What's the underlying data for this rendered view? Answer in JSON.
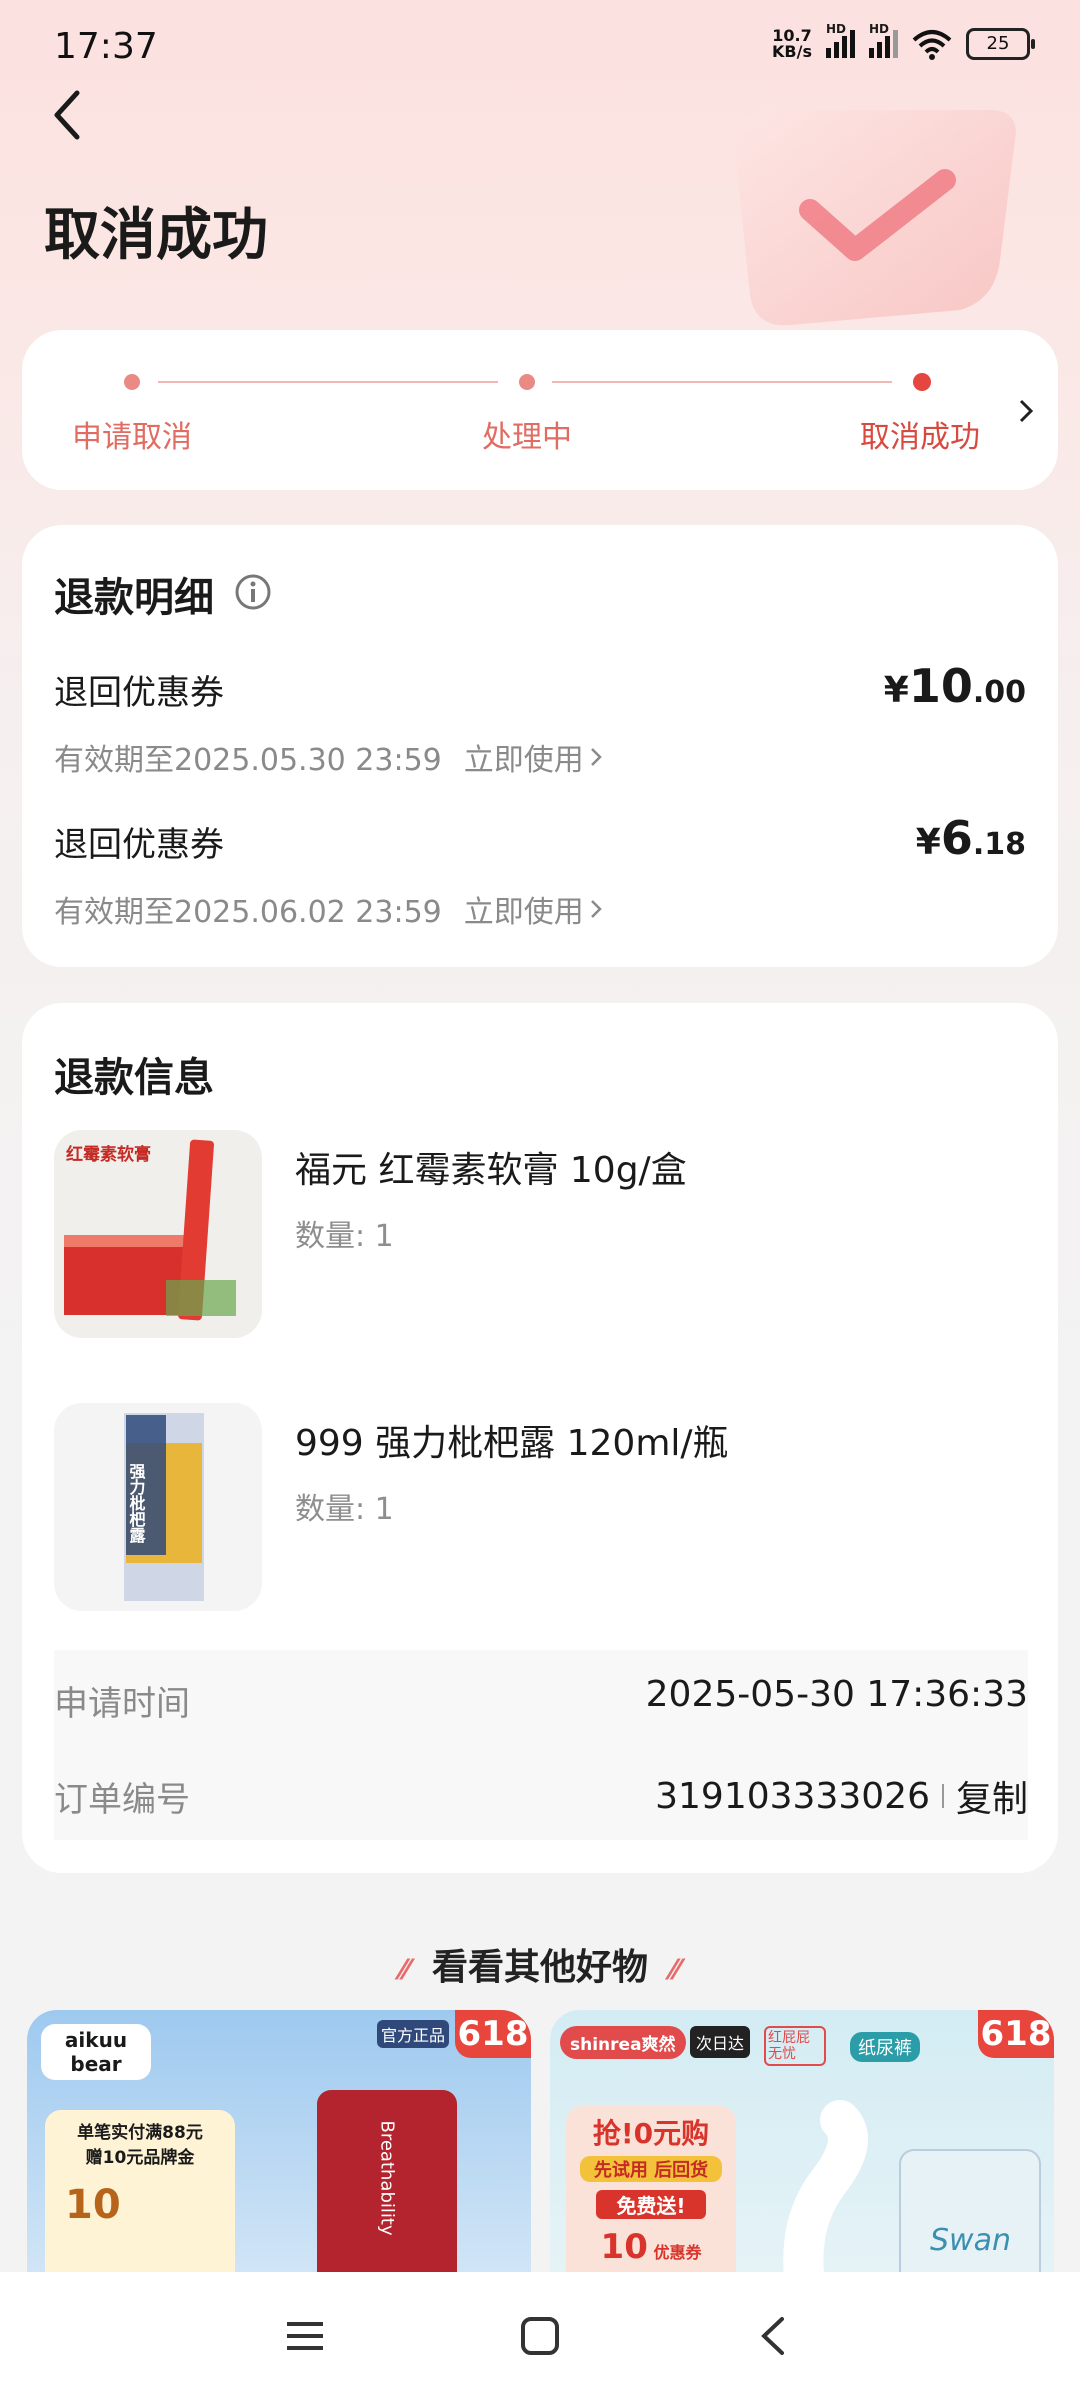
{
  "status_bar": {
    "time": "17:37",
    "speed_value": "10.7",
    "speed_unit": "KB/s",
    "hd1": "HD",
    "hd2": "HD",
    "battery": "25"
  },
  "header": {
    "title": "取消成功"
  },
  "progress": {
    "steps": [
      {
        "label": "申请取消"
      },
      {
        "label": "处理中"
      },
      {
        "label": "取消成功"
      }
    ]
  },
  "refund_detail": {
    "title": "退款明细",
    "coupons": [
      {
        "name": "退回优惠券",
        "currency": "¥",
        "amount_int": "10",
        "amount_dec": ".00",
        "validity": "有效期至2025.05.30 23:59",
        "use_label": "立即使用"
      },
      {
        "name": "退回优惠券",
        "currency": "¥",
        "amount_int": "6",
        "amount_dec": ".18",
        "validity": "有效期至2025.06.02 23:59",
        "use_label": "立即使用"
      }
    ]
  },
  "refund_info": {
    "title": "退款信息",
    "products": [
      {
        "name": "福元 红霉素软膏 10g/盒",
        "qty": "数量: 1",
        "thumb_text": "红霉素软膏"
      },
      {
        "name": "999 强力枇杷露 120ml/瓶",
        "qty": "数量: 1",
        "thumb_text": "强力枇杷露"
      }
    ],
    "apply_time_label": "申请时间",
    "apply_time_value": "2025-05-30 17:36:33",
    "order_no_label": "订单编号",
    "order_no_value": "319103333026",
    "copy_label": "复制"
  },
  "recommend": {
    "title": "看看其他好物",
    "items": [
      {
        "brand": "aikuu bear",
        "badge": "618",
        "promo1": "单笔实付满88元",
        "promo2": "赠10元品牌金",
        "promo_amount": "10",
        "product_text": "Breathability",
        "tag": "官方正品"
      },
      {
        "brand": "shinrea爽然",
        "badge": "618",
        "promo1": "抢!0元购",
        "promo2": "先试用 后回货",
        "promo3": "免费送!",
        "promo_amount": "10",
        "promo_unit": "优惠券",
        "product_text": "Swan",
        "tag1": "次日达",
        "tag2": "红屁屁无忧",
        "tag3": "纸尿裤"
      }
    ]
  },
  "colors": {
    "accent": "#e5463f",
    "step_inactive": "#e98a85"
  }
}
